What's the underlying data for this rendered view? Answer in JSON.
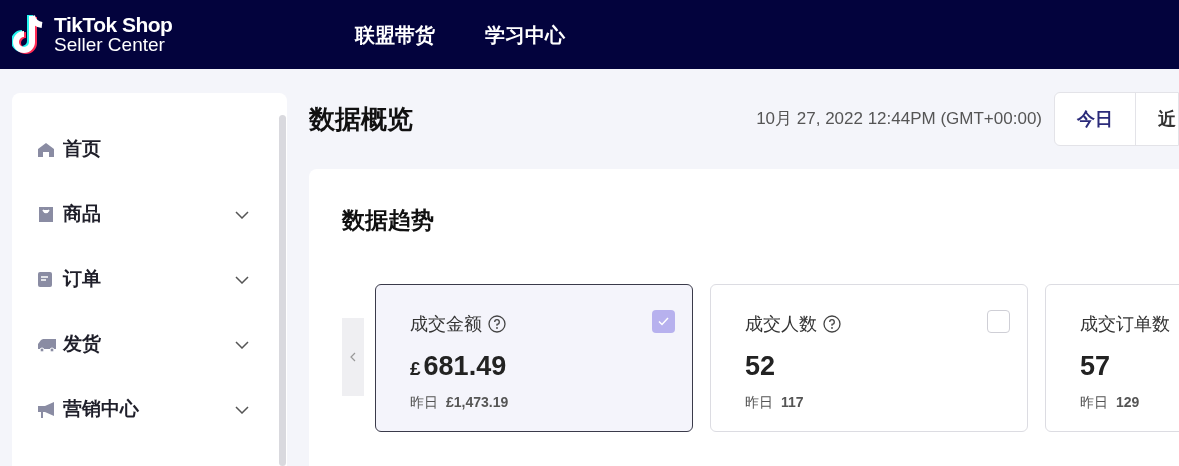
{
  "header": {
    "logo_title": "TikTok Shop",
    "logo_subtitle": "Seller Center",
    "nav": [
      {
        "label": "联盟带货"
      },
      {
        "label": "学习中心"
      }
    ]
  },
  "sidebar": {
    "items": [
      {
        "label": "首页",
        "expandable": false
      },
      {
        "label": "商品",
        "expandable": true
      },
      {
        "label": "订单",
        "expandable": true
      },
      {
        "label": "发货",
        "expandable": true
      },
      {
        "label": "营销中心",
        "expandable": true
      }
    ]
  },
  "page": {
    "title": "数据概览",
    "timestamp": "10月 27, 2022 12:44PM (GMT+00:00)",
    "range_tabs": [
      {
        "label": "今日",
        "selected": true
      },
      {
        "label": "近",
        "selected": false
      }
    ]
  },
  "trend": {
    "title": "数据趋势",
    "cards": [
      {
        "title": "成交金额",
        "help": true,
        "currency": "£",
        "value": "681.49",
        "compare_label": "昨日",
        "compare_value": "£1,473.19",
        "checked": true
      },
      {
        "title": "成交人数",
        "help": true,
        "value": "52",
        "compare_label": "昨日",
        "compare_value": "117",
        "checked": false
      },
      {
        "title": "成交订单数",
        "help": false,
        "value": "57",
        "compare_label": "昨日",
        "compare_value": "129"
      }
    ]
  }
}
